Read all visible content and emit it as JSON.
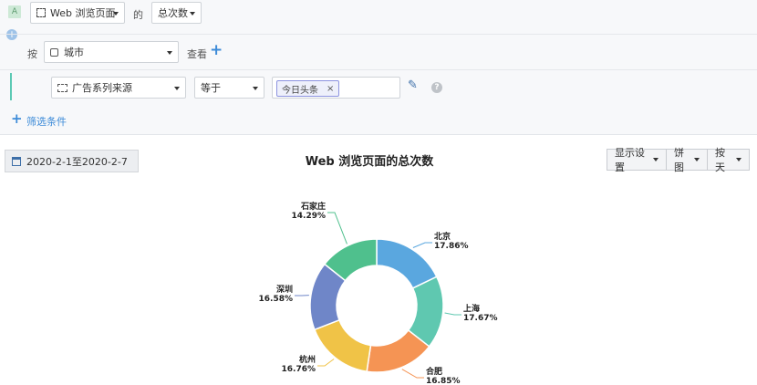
{
  "query": {
    "badge": "A",
    "event": "Web 浏览页面",
    "of_label": "的",
    "metric": "总次数",
    "group_by_label": "按",
    "group_by": "城市",
    "view_label": "查看"
  },
  "filter": {
    "property": "广告系列来源",
    "operator": "等于",
    "tags": [
      "今日头条"
    ],
    "add_filter_label": "筛选条件"
  },
  "toolbar": {
    "date_range": "2020-2-1至2020-2-7",
    "display_settings": "显示设置",
    "chart_type": "饼图",
    "granularity": "按天"
  },
  "chart_data": {
    "type": "pie",
    "style": "donut",
    "title": "Web 浏览页面的总次数",
    "slices": [
      {
        "label": "北京",
        "percent": 17.86,
        "percent_text": "17.86%",
        "color": "#5aa7df"
      },
      {
        "label": "上海",
        "percent": 17.67,
        "percent_text": "17.67%",
        "color": "#5fc8b0"
      },
      {
        "label": "合肥",
        "percent": 16.85,
        "percent_text": "16.85%",
        "color": "#f59454"
      },
      {
        "label": "杭州",
        "percent": 16.76,
        "percent_text": "16.76%",
        "color": "#f0c347"
      },
      {
        "label": "深圳",
        "percent": 16.58,
        "percent_text": "16.58%",
        "color": "#6f86c8"
      },
      {
        "label": "石家庄",
        "percent": 14.29,
        "percent_text": "14.29%",
        "color": "#4fc08d"
      }
    ]
  },
  "colors": {
    "accent": "#3d8bd8",
    "tag_border": "#8c93e0",
    "filter_bar": "#5cc9b4"
  }
}
